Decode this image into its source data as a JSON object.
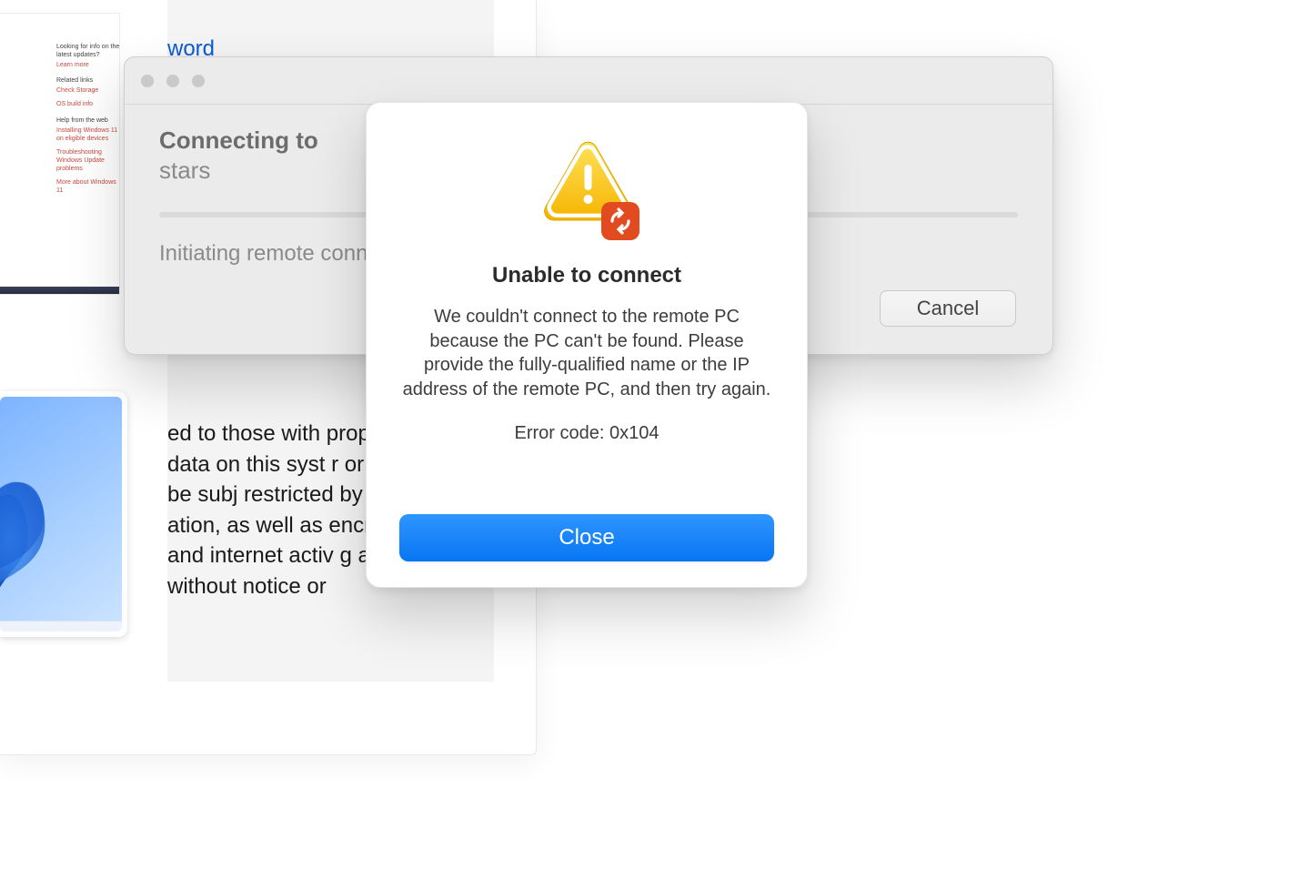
{
  "bottom_panel": {
    "link_text": "word",
    "body_text": "ed to those with proper access data on this syst r or access may be subj restricted by local law, a ation, as well as encryp email and internet activ g at any time without notice or"
  },
  "thumb": {
    "line1": "Looking for info on the latest updates?",
    "learn": "Learn more",
    "section1": "Related links",
    "l1": "Check Storage",
    "l2": "OS build info",
    "section2": "Help from the web",
    "l3": "Installing Windows 11 on eligible devices",
    "l4": "Troubleshooting Windows Update problems",
    "l5": "More about Windows 11"
  },
  "connect": {
    "title": "Connecting to",
    "destination": "stars",
    "status": "Initiating remote connection...",
    "cancel": "Cancel"
  },
  "modal": {
    "title": "Unable to connect",
    "message": "We couldn't connect to the remote PC because the PC can't be found. Please provide the fully-qualified name or the IP address of the remote PC, and then try again.",
    "error": "Error code: 0x104",
    "close": "Close"
  }
}
